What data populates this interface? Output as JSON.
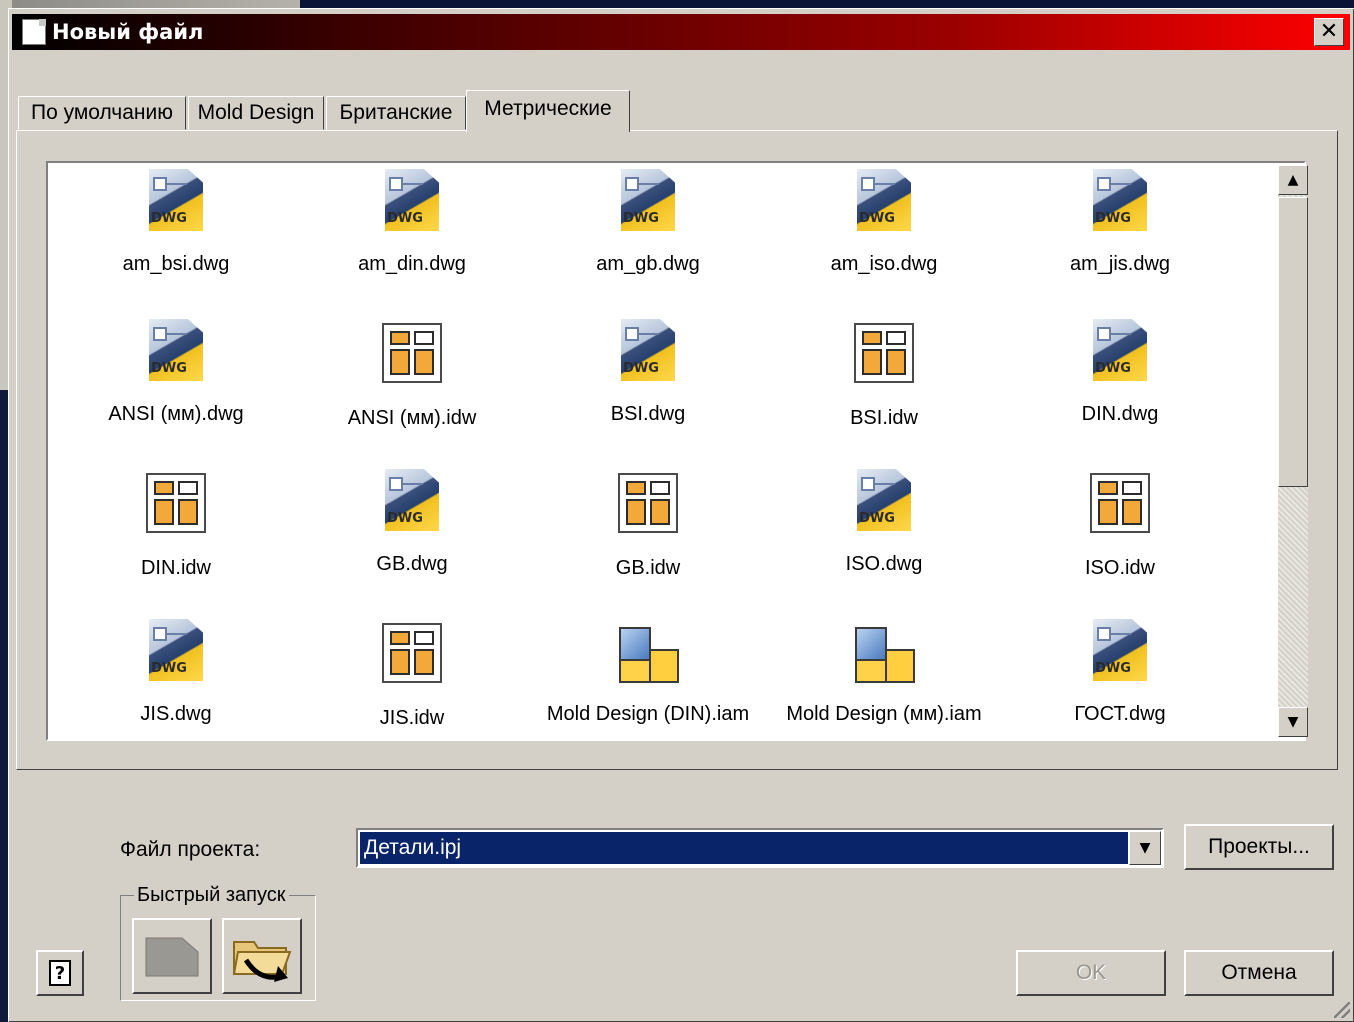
{
  "window": {
    "title": "Новый файл",
    "close_label": "✕"
  },
  "tabs": [
    {
      "label": "По умолчанию",
      "active": false
    },
    {
      "label": "Mold Design",
      "active": false
    },
    {
      "label": "Британские",
      "active": false
    },
    {
      "label": "Метрические",
      "active": true
    }
  ],
  "files": [
    {
      "name": "am_bsi.dwg",
      "icon": "dwg-file-icon",
      "type": "dwg"
    },
    {
      "name": "am_din.dwg",
      "icon": "dwg-file-icon",
      "type": "dwg"
    },
    {
      "name": "am_gb.dwg",
      "icon": "dwg-file-icon",
      "type": "dwg"
    },
    {
      "name": "am_iso.dwg",
      "icon": "dwg-file-icon",
      "type": "dwg"
    },
    {
      "name": "am_jis.dwg",
      "icon": "dwg-file-icon",
      "type": "dwg"
    },
    {
      "name": "ANSI (мм).dwg",
      "icon": "dwg-file-icon",
      "type": "dwg"
    },
    {
      "name": "ANSI (мм).idw",
      "icon": "idw-drawing-icon",
      "type": "idw"
    },
    {
      "name": "BSI.dwg",
      "icon": "dwg-file-icon",
      "type": "dwg"
    },
    {
      "name": "BSI.idw",
      "icon": "idw-drawing-icon",
      "type": "idw"
    },
    {
      "name": "DIN.dwg",
      "icon": "dwg-file-icon",
      "type": "dwg"
    },
    {
      "name": "DIN.idw",
      "icon": "idw-drawing-icon",
      "type": "idw"
    },
    {
      "name": "GB.dwg",
      "icon": "dwg-file-icon",
      "type": "dwg"
    },
    {
      "name": "GB.idw",
      "icon": "idw-drawing-icon",
      "type": "idw"
    },
    {
      "name": "ISO.dwg",
      "icon": "dwg-file-icon",
      "type": "dwg"
    },
    {
      "name": "ISO.idw",
      "icon": "idw-drawing-icon",
      "type": "idw"
    },
    {
      "name": "JIS.dwg",
      "icon": "dwg-file-icon",
      "type": "dwg"
    },
    {
      "name": "JIS.idw",
      "icon": "idw-drawing-icon",
      "type": "idw"
    },
    {
      "name": "Mold Design (DIN).iam",
      "icon": "iam-assembly-icon",
      "type": "iam"
    },
    {
      "name": "Mold Design (мм).iam",
      "icon": "iam-assembly-icon",
      "type": "iam"
    },
    {
      "name": "ГОСТ.dwg",
      "icon": "dwg-file-icon",
      "type": "dwg"
    }
  ],
  "dwg_badge": "DWG",
  "project": {
    "label": "Файл проекта:",
    "value": "Детали.ipj"
  },
  "buttons": {
    "projects": "Проекты...",
    "ok": "OK",
    "cancel": "Отмена"
  },
  "quick_launch": {
    "label": "Быстрый запуск"
  },
  "help_label": "?",
  "colors": {
    "dialog_bg": "#d4d0c8",
    "selection": "#0a246a",
    "title_gradient_end": "#ff0000"
  }
}
